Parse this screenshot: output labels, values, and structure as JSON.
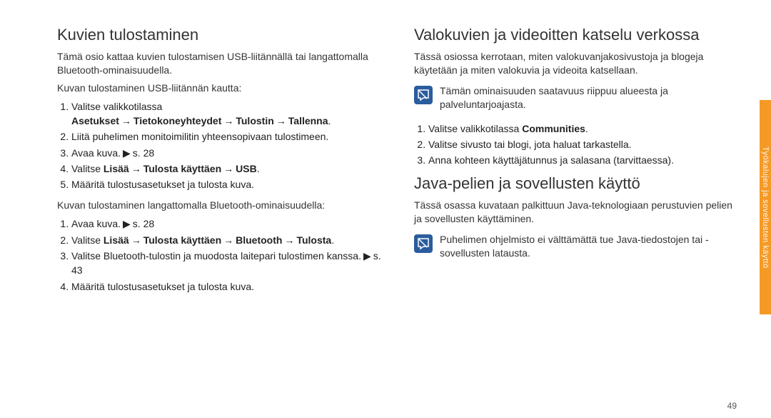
{
  "page_number": "49",
  "side_tab": "Työkalujen ja sovellusten käyttö",
  "left": {
    "heading": "Kuvien tulostaminen",
    "intro": "Tämä osio kattaa kuvien tulostamisen USB-liitännällä tai langattomalla Bluetooth-ominaisuudella.",
    "sub1": "Kuvan tulostaminen USB-liitännän kautta:",
    "list1": {
      "s1_pre": "Valitse valikkotilassa ",
      "s1_b1": "Asetukset",
      "s1_b2": "Tietokoneyhteydet",
      "s1_b3": "Tulostin",
      "s1_b4": "Tallenna",
      "s2": "Liitä puhelimen monitoimilitin yhteensopivaan tulostimeen.",
      "s3_pre": "Avaa kuva.",
      "s3_ref": "s. 28",
      "s4_pre": "Valitse ",
      "s4_b1": "Lisää",
      "s4_b2": "Tulosta käyttäen",
      "s4_b3": "USB",
      "s5": "Määritä tulostusasetukset ja tulosta kuva."
    },
    "sub2": "Kuvan tulostaminen langattomalla Bluetooth-ominaisuudella:",
    "list2": {
      "s1_pre": "Avaa kuva.",
      "s1_ref": "s. 28",
      "s2_pre": "Valitse ",
      "s2_b1": "Lisää",
      "s2_b2": "Tulosta käyttäen",
      "s2_b3": "Bluetooth",
      "s2_b4": "Tulosta",
      "s3_pre": "Valitse Bluetooth-tulostin ja muodosta laitepari tulostimen kanssa.",
      "s3_ref": "s. 43",
      "s4": "Määritä tulostusasetukset ja tulosta kuva."
    }
  },
  "right": {
    "h1": "Valokuvien ja videoitten katselu verkossa",
    "p1": "Tässä osiossa kerrotaan, miten valokuvanjakosivustoja ja blogeja käytetään ja miten valokuvia ja videoita katsellaan.",
    "note1": "Tämän ominaisuuden saatavuus riippuu alueesta ja palveluntarjoajasta.",
    "list1": {
      "s1_pre": "Valitse valikkotilassa ",
      "s1_b": "Communities",
      "s2": "Valitse sivusto tai blogi, jota haluat tarkastella.",
      "s3": "Anna kohteen käyttäjätunnus ja salasana (tarvittaessa)."
    },
    "h2": "Java-pelien ja sovellusten käyttö",
    "p2": "Tässä osassa kuvataan palkittuun Java-teknologiaan perustuvien pelien ja sovellusten käyttäminen.",
    "note2": "Puhelimen ohjelmisto ei välttämättä tue Java-tiedostojen tai -sovellusten latausta."
  }
}
